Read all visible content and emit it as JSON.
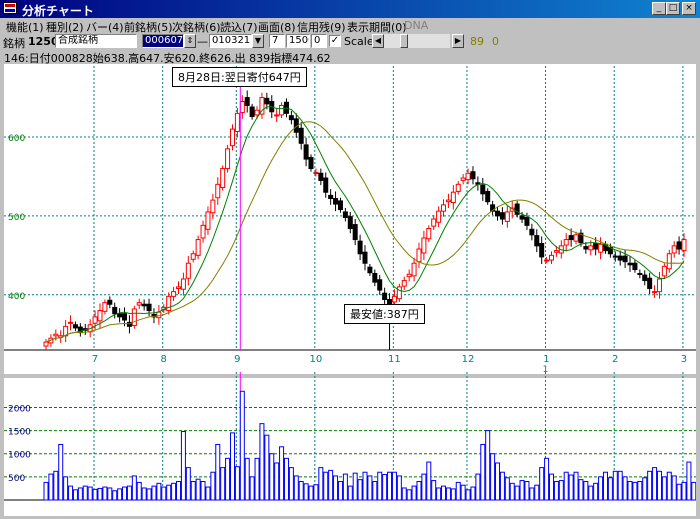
{
  "window": {
    "title": "分析チャート",
    "minimize": "_",
    "maximize": "□",
    "close": "×"
  },
  "menu": [
    {
      "label": "機能(1)"
    },
    {
      "label": "種別(2)"
    },
    {
      "label": "バー(4)"
    },
    {
      "label": "前銘柄(5)"
    },
    {
      "label": "次銘柄(6)"
    },
    {
      "label": "読込(7)"
    },
    {
      "label": "画面(8)"
    },
    {
      "label": "信用残(9)"
    },
    {
      "label": "表示期間(0)"
    },
    {
      "label": "DNA",
      "disabled": true
    }
  ],
  "toolbar": {
    "code_label": "銘柄",
    "code_value": "1250",
    "name_value": "合成銘柄",
    "start_value": "000607",
    "dash": "—",
    "end_value": "010321",
    "param1": "7",
    "param2": "1500",
    "param3": "0",
    "scale_checked": true,
    "scale_label": "Scale",
    "left_arrow": "◀",
    "right_arrow": "▶",
    "num_a": "89",
    "num_b": "0"
  },
  "info_line": "146:日付000828始638.高647.安620.終626.出 839指標474.62",
  "callouts": {
    "top": "8月28日:翌日寄付647円",
    "bottom": "最安値:387円"
  },
  "colors": {
    "up": "#ff0000",
    "down": "#000000",
    "ma_short": "#008000",
    "ma_long": "#808000",
    "cursor": "#ff00ff",
    "grid": "#008080",
    "volume": "#0000ff",
    "volume_grid": "#008000"
  },
  "chart_data": [
    {
      "type": "candlestick",
      "title": "",
      "y_ticks": [
        400,
        500,
        600
      ],
      "ylim": [
        330,
        690
      ],
      "x_tick_labels": [
        "7",
        "8",
        "9",
        "10",
        "11",
        "12",
        "1",
        "2",
        "3"
      ],
      "x_sub_label": "1",
      "x_sub_label_under": "1",
      "close": [
        340,
        345,
        350,
        348,
        360,
        365,
        358,
        352,
        355,
        362,
        372,
        380,
        390,
        388,
        376,
        372,
        368,
        360,
        382,
        390,
        386,
        380,
        372,
        378,
        384,
        398,
        404,
        410,
        420,
        440,
        452,
        470,
        488,
        505,
        520,
        540,
        560,
        585,
        610,
        630,
        645,
        640,
        626,
        634,
        650,
        642,
        632,
        628,
        640,
        630,
        622,
        606,
        592,
        572,
        560,
        555,
        545,
        530,
        522,
        515,
        508,
        498,
        484,
        470,
        452,
        440,
        428,
        416,
        406,
        394,
        387,
        398,
        410,
        418,
        426,
        440,
        458,
        472,
        484,
        496,
        506,
        514,
        520,
        530,
        540,
        548,
        554,
        547,
        540,
        528,
        518,
        506,
        500,
        496,
        505,
        510,
        502,
        496,
        488,
        476,
        462,
        448,
        444,
        450,
        456,
        462,
        470,
        470,
        476,
        466,
        458,
        462,
        458,
        464,
        456,
        452,
        448,
        444,
        442,
        438,
        432,
        426,
        418,
        408,
        404,
        420,
        436,
        452,
        462,
        458,
        470
      ],
      "volume_y_ticks": [
        500,
        1000,
        1500,
        2000
      ],
      "volume_ylim": [
        0,
        2550
      ],
      "volume": [
        380,
        560,
        620,
        1200,
        500,
        300,
        220,
        260,
        300,
        280,
        230,
        250,
        280,
        260,
        200,
        240,
        280,
        300,
        520,
        380,
        260,
        240,
        300,
        360,
        280,
        320,
        360,
        400,
        1480,
        700,
        400,
        450,
        400,
        280,
        600,
        1200,
        700,
        900,
        1450,
        720,
        2350,
        900,
        500,
        900,
        1650,
        1400,
        1000,
        800,
        1150,
        900,
        700,
        520,
        400,
        350,
        300,
        330,
        700,
        600,
        640,
        520,
        400,
        560,
        300,
        580,
        440,
        600,
        520,
        400,
        600,
        550,
        600,
        600,
        520,
        260,
        220,
        300,
        400,
        560,
        820,
        420,
        260,
        300,
        260,
        240,
        380,
        320,
        220,
        280,
        560,
        1200,
        1500,
        1000,
        800,
        600,
        480,
        360,
        300,
        420,
        400,
        260,
        320,
        700,
        900,
        560,
        400,
        420,
        600,
        540,
        600,
        440,
        400,
        300,
        360,
        500,
        600,
        480,
        620,
        620,
        500,
        400,
        380,
        400,
        480,
        620,
        700,
        620,
        500,
        600,
        520,
        340,
        380,
        820,
        380,
        600,
        800,
        300
      ]
    }
  ]
}
